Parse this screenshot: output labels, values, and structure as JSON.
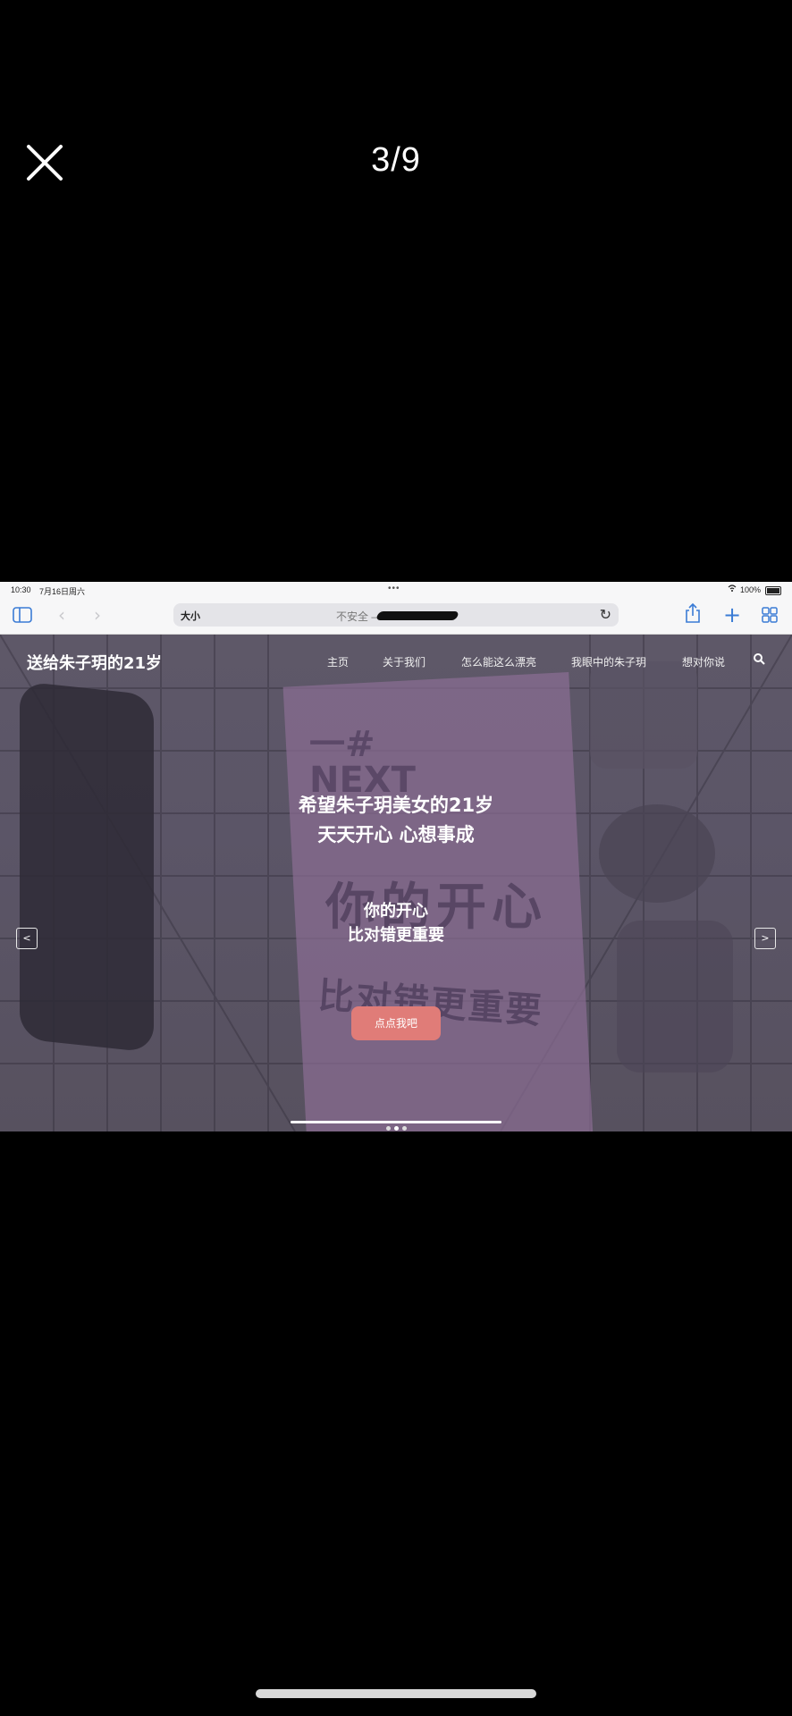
{
  "viewer": {
    "counter": "3/9",
    "close_icon": "close-icon"
  },
  "status_bar": {
    "time": "10:30",
    "date": "7月16日周六",
    "dots": "•••",
    "battery_pct": "100%"
  },
  "browser": {
    "text_size_label": "大小",
    "security_label": "不安全 —",
    "reload_icon": "reload-icon",
    "icons": [
      "sidebar-icon",
      "back-icon",
      "forward-icon",
      "share-icon",
      "new-tab-icon",
      "tabs-icon"
    ]
  },
  "site": {
    "title": "送给朱子玥的21岁",
    "nav": [
      "主页",
      "关于我们",
      "怎么能这么漂亮",
      "我眼中的朱子玥",
      "想对你说"
    ],
    "search_icon": "search-icon"
  },
  "hero": {
    "headline_line1": "希望朱子玥美女的21岁",
    "headline_line2": "天天开心 心想事成",
    "sub_line1": "你的开心",
    "sub_line2": "比对错更重要",
    "cta_label": "点点我吧",
    "prev_label": "<",
    "next_label": ">",
    "background_text": [
      "一#",
      "NEXT",
      "你的开心",
      "比对错更重要"
    ]
  },
  "colors": {
    "cta": "#e07c78",
    "link": "#3a7bd5"
  }
}
